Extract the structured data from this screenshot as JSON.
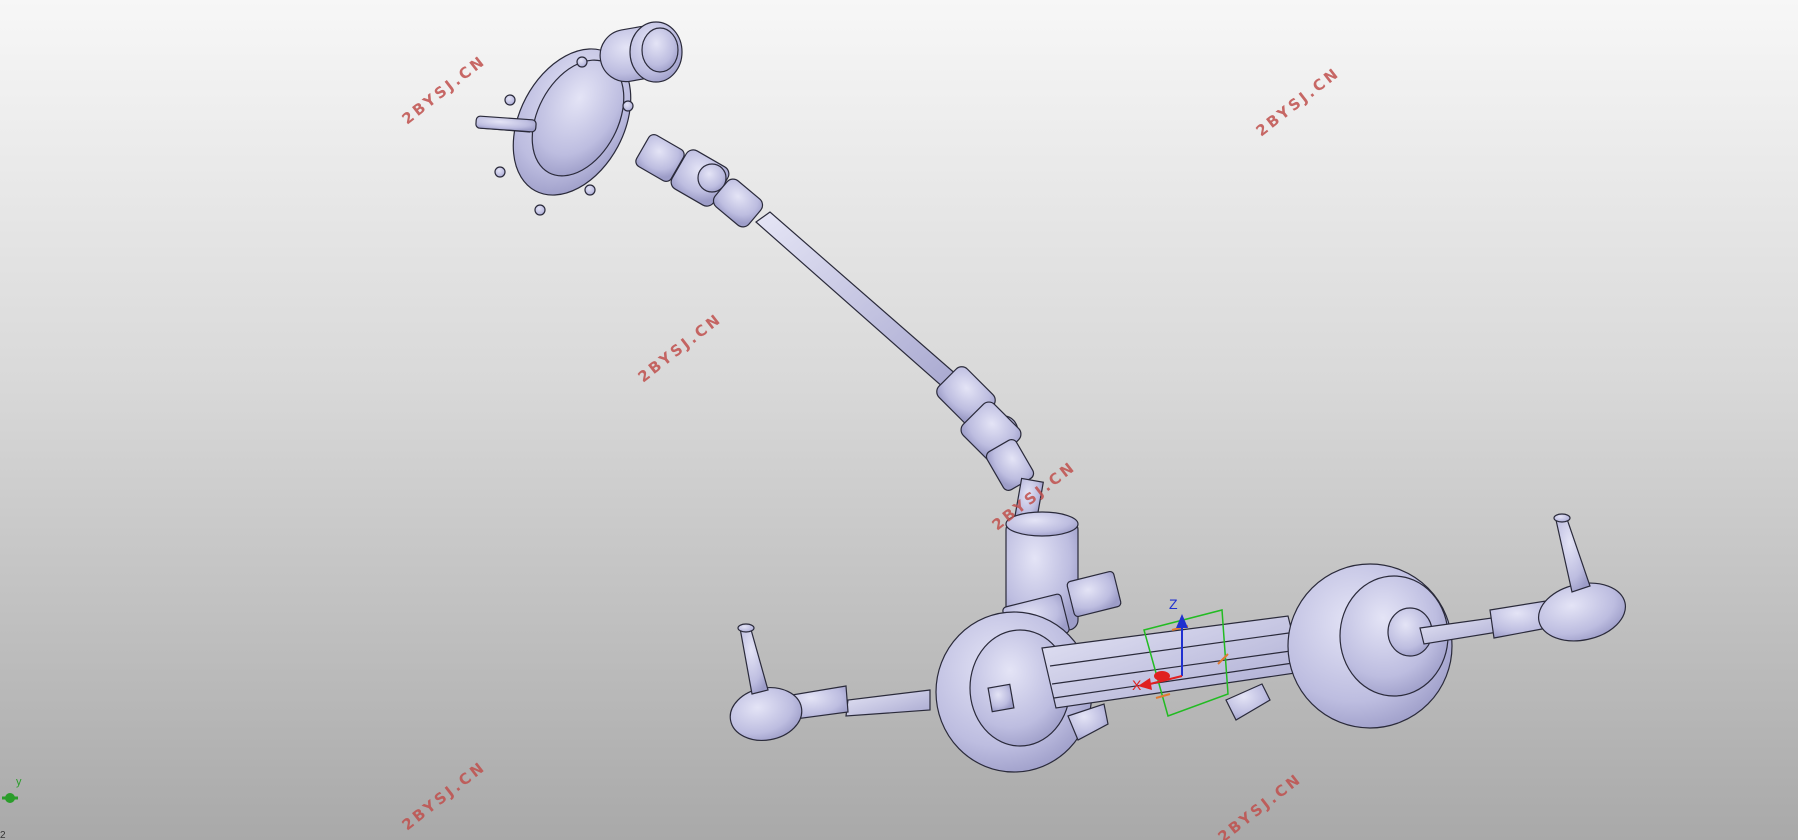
{
  "watermark": {
    "text": "2BYSJ.CN",
    "color": "#c0504d"
  },
  "compass": {
    "x_label": "X",
    "z_label": "Z",
    "x_color": "#e02020",
    "z_color": "#2030d0",
    "plane_color": "#22bb22"
  },
  "triad": {
    "y_label": "y",
    "color": "#2a9d2a"
  },
  "corner_text": "2",
  "model": {
    "part_color": "#c9c9e6",
    "edge_color": "#2a2a3a"
  }
}
